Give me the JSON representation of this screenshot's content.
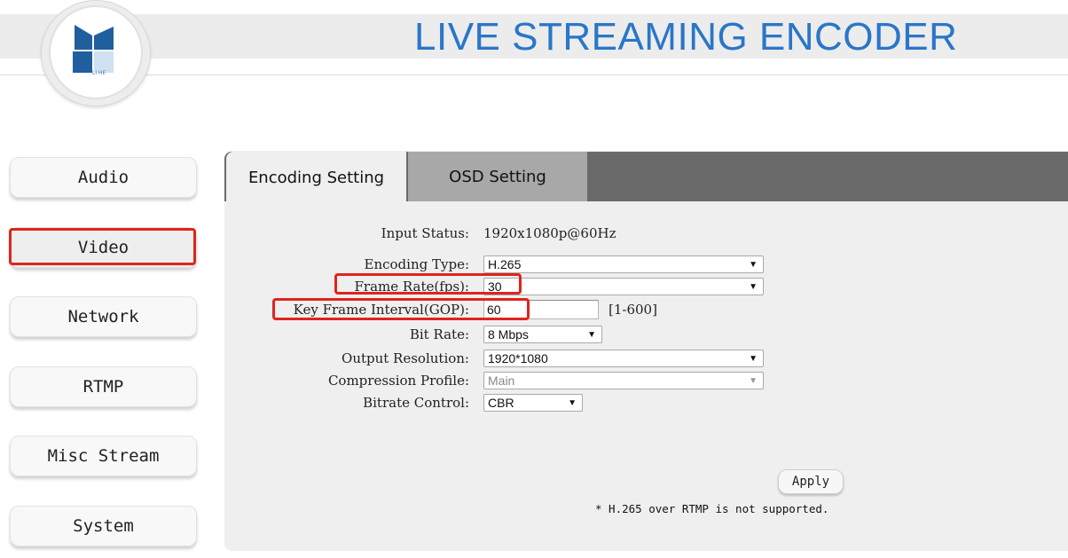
{
  "header": {
    "title": "LIVE STREAMING ENCODER",
    "logo_text": "LI HE",
    "brand_color": "#2a76c8"
  },
  "sidebar": {
    "items": [
      {
        "label": "Audio",
        "icon": ""
      },
      {
        "label": "Video",
        "active": true
      },
      {
        "label": "Network"
      },
      {
        "label": "RTMP"
      },
      {
        "label": "Misc Stream"
      },
      {
        "label": "System"
      }
    ]
  },
  "tabs": [
    {
      "label": "Encoding Setting",
      "active": true
    },
    {
      "label": "OSD Setting",
      "active": false
    }
  ],
  "form": {
    "input_status": {
      "label": "Input Status:",
      "value": "1920x1080p@60Hz"
    },
    "encoding_type": {
      "label": "Encoding Type:",
      "value": "H.265"
    },
    "frame_rate": {
      "label": "Frame Rate(fps):",
      "value": "30"
    },
    "gop": {
      "label": "Key Frame Interval(GOP):",
      "value": "60",
      "range": "[1-600]"
    },
    "bit_rate": {
      "label": "Bit Rate:",
      "value": "8 Mbps"
    },
    "output_resolution": {
      "label": "Output Resolution:",
      "value": "1920*1080"
    },
    "compression_profile": {
      "label": "Compression Profile:",
      "value": "Main",
      "disabled": true
    },
    "bitrate_control": {
      "label": "Bitrate Control:",
      "value": "CBR"
    }
  },
  "apply_label": "Apply",
  "note": "* H.265 over RTMP is not supported.",
  "highlight_color": "#e0241c"
}
